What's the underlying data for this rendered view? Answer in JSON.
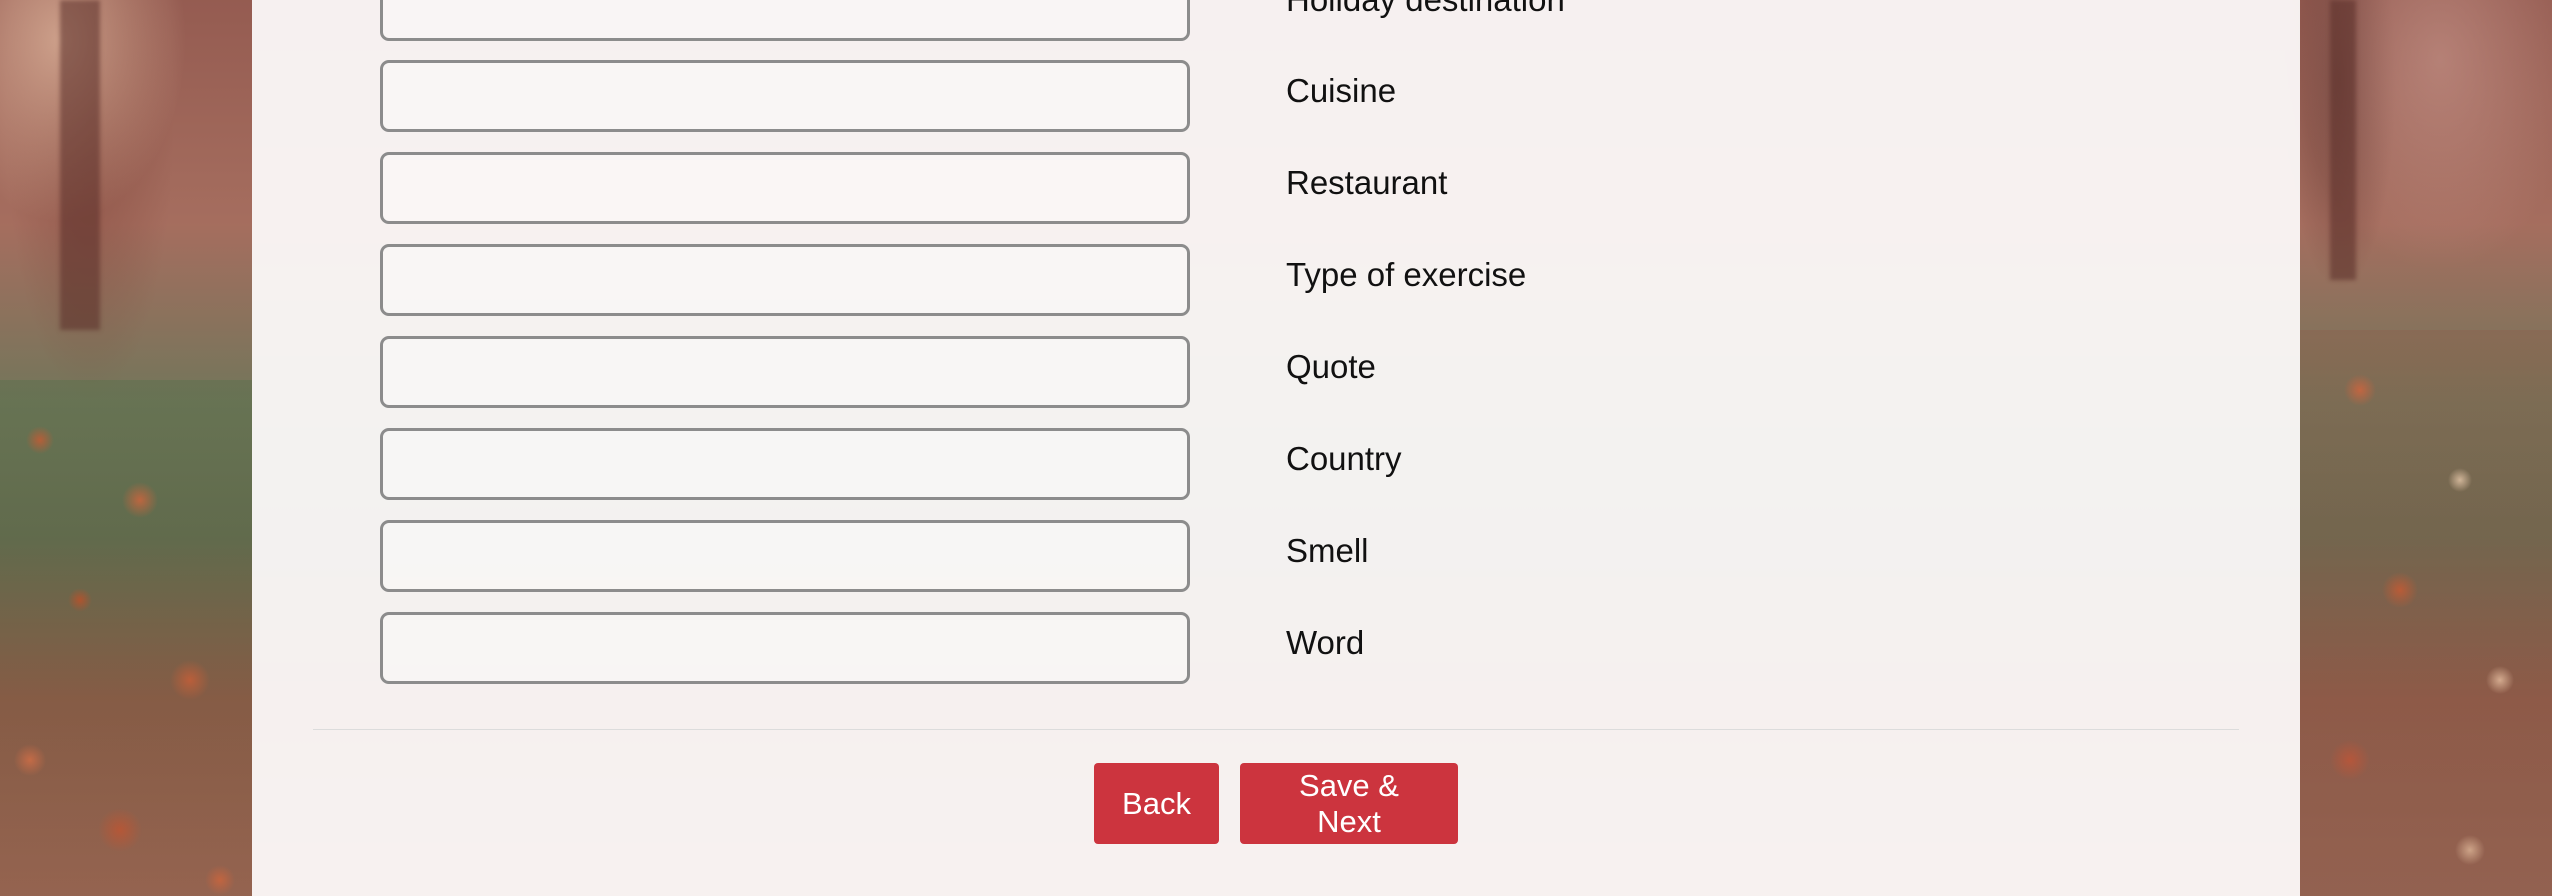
{
  "form": {
    "fields": [
      {
        "label": "Holiday destination",
        "value": ""
      },
      {
        "label": "Cuisine",
        "value": ""
      },
      {
        "label": "Restaurant",
        "value": ""
      },
      {
        "label": "Type of exercise",
        "value": ""
      },
      {
        "label": "Quote",
        "value": ""
      },
      {
        "label": "Country",
        "value": ""
      },
      {
        "label": "Smell",
        "value": ""
      },
      {
        "label": "Word",
        "value": ""
      }
    ]
  },
  "actions": {
    "back_label": "Back",
    "next_label": "Save & Next"
  },
  "colors": {
    "button": "#cc343e",
    "input_border": "#8c8c8c",
    "panel": "#fcfafa"
  }
}
